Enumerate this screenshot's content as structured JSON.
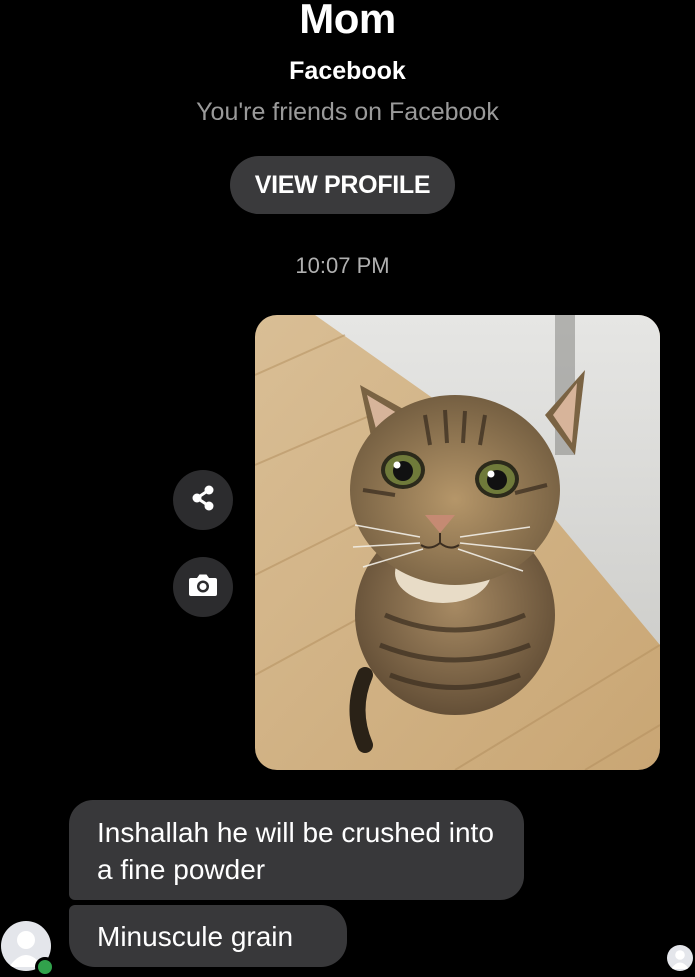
{
  "header": {
    "contact_name": "Mom",
    "network": "Facebook",
    "relationship": "You're friends on Facebook",
    "view_profile_label": "VIEW PROFILE"
  },
  "thread": {
    "timestamp": "10:07 PM",
    "sent_photo": {
      "icon": "cat-photo",
      "actions": [
        "share-icon",
        "camera-icon"
      ]
    },
    "messages": [
      {
        "text": "Inshallah he will be crushed into a fine powder"
      },
      {
        "text": "Minuscule grain"
      }
    ]
  },
  "colors": {
    "background": "#000000",
    "bubble": "#38383a",
    "button": "#3a3a3c",
    "secondary_text": "#9a9a9a",
    "online": "#31a24c"
  }
}
